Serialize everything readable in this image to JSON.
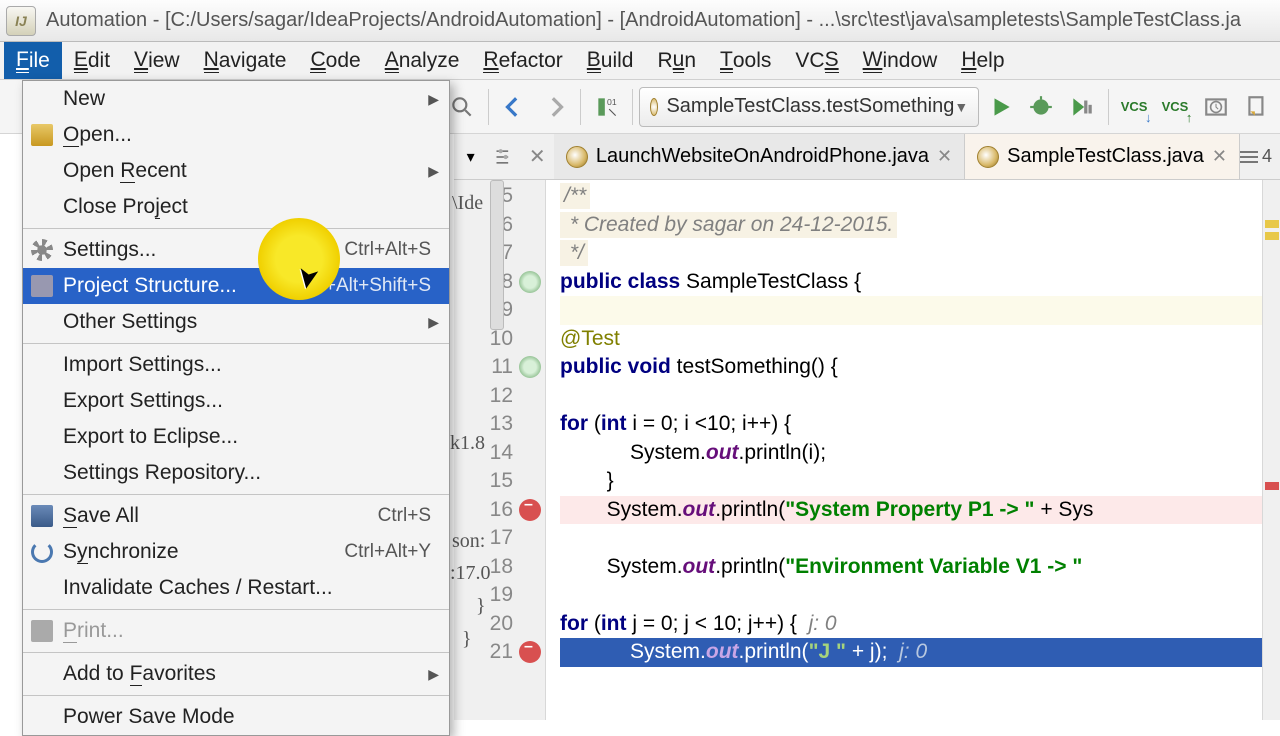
{
  "title": "Automation - [C:/Users/sagar/IdeaProjects/AndroidAutomation] - [AndroidAutomation] - ...\\src\\test\\java\\sampletests\\SampleTestClass.ja",
  "menubar": [
    "File",
    "Edit",
    "View",
    "Navigate",
    "Code",
    "Analyze",
    "Refactor",
    "Build",
    "Run",
    "Tools",
    "VCS",
    "Window",
    "Help"
  ],
  "menubar_mnemonics": [
    "F",
    "E",
    "V",
    "N",
    "C",
    "A",
    "R",
    "B",
    "u",
    "T",
    "S",
    "W",
    "H"
  ],
  "run_config": "SampleTestClass.testSomething",
  "toolbar_right_labels": {
    "vcs1": "VCS",
    "vcs2": "VCS"
  },
  "file_menu": [
    {
      "type": "item",
      "label": "New",
      "arrow": true
    },
    {
      "type": "item",
      "label": "Open...",
      "icon": "folder",
      "mn": "O"
    },
    {
      "type": "item",
      "label": "Open Recent",
      "arrow": true,
      "mn": "R"
    },
    {
      "type": "item",
      "label": "Close Project",
      "mn": "j"
    },
    {
      "type": "sep"
    },
    {
      "type": "item",
      "label": "Settings...",
      "shortcut": "Ctrl+Alt+S",
      "icon": "gear",
      "highlight": "yellow"
    },
    {
      "type": "item",
      "label": "Project Structure...",
      "shortcut": "Ctrl+Alt+Shift+S",
      "icon": "proj",
      "sel": true
    },
    {
      "type": "item",
      "label": "Other Settings",
      "arrow": true
    },
    {
      "type": "sep"
    },
    {
      "type": "item",
      "label": "Import Settings..."
    },
    {
      "type": "item",
      "label": "Export Settings..."
    },
    {
      "type": "item",
      "label": "Export to Eclipse..."
    },
    {
      "type": "item",
      "label": "Settings Repository..."
    },
    {
      "type": "sep"
    },
    {
      "type": "item",
      "label": "Save All",
      "shortcut": "Ctrl+S",
      "icon": "save",
      "mn": "S"
    },
    {
      "type": "item",
      "label": "Synchronize",
      "shortcut": "Ctrl+Alt+Y",
      "icon": "sync",
      "mn": "y"
    },
    {
      "type": "item",
      "label": "Invalidate Caches / Restart..."
    },
    {
      "type": "sep"
    },
    {
      "type": "item",
      "label": "Print...",
      "icon": "print",
      "dis": true,
      "mn": "P"
    },
    {
      "type": "sep"
    },
    {
      "type": "item",
      "label": "Add to Favorites",
      "arrow": true,
      "mn": "F"
    },
    {
      "type": "sep"
    },
    {
      "type": "item",
      "label": "Power Save Mode"
    }
  ],
  "editor_tabs": [
    {
      "name": "LaunchWebsiteOnAndroidPhone.java",
      "active": false
    },
    {
      "name": "SampleTestClass.java",
      "active": true
    }
  ],
  "tabs_right_count": "4",
  "behind_fragments": {
    "ide": "\\Ide",
    "k18": "k1.8",
    "son": "son:",
    "v17": ":17.0",
    "rb1": "}",
    "rb2": "}"
  },
  "code_lines": [
    {
      "n": 5,
      "html": "<span class='doc-bg'><span class='k-doc'>/**</span></span>"
    },
    {
      "n": 6,
      "html": "<span class='doc-bg'><span class='k-doc'> * Created by sagar on 24-12-2015.</span></span>"
    },
    {
      "n": 7,
      "html": "<span class='doc-bg'><span class='k-doc'> */</span></span>"
    },
    {
      "n": 8,
      "icon": "refresh",
      "html": "<span class='k-key'>public class</span> SampleTestClass {"
    },
    {
      "n": 9,
      "cls": "line-hl",
      "html": ""
    },
    {
      "n": 10,
      "html": "    <span class='k-ann'>@Test</span>"
    },
    {
      "n": 11,
      "icon": "refresh",
      "html": "    <span class='k-key'>public void</span> testSomething() {"
    },
    {
      "n": 12,
      "html": ""
    },
    {
      "n": 13,
      "html": "        <span class='k-key'>for</span> (<span class='k-key'>int</span> i = 0; i &lt;10; i++) {"
    },
    {
      "n": 14,
      "html": "            System.<span class='k-fld'>out</span>.println(i);"
    },
    {
      "n": 15,
      "html": "        }"
    },
    {
      "n": 16,
      "icon": "err",
      "cls": "line-err",
      "html": "        System.<span class='k-fld'>out</span>.println(<span class='k-str'>\"System Property P1 -&gt; \"</span> + Sys"
    },
    {
      "n": 17,
      "html": ""
    },
    {
      "n": 18,
      "html": "        System.<span class='k-fld'>out</span>.println(<span class='k-str'>\"Environment Variable V1 -&gt; \"</span>"
    },
    {
      "n": 19,
      "html": ""
    },
    {
      "n": 20,
      "html": "        <span class='k-key'>for</span> (<span class='k-key'>int</span> j = 0; j &lt; 10; j++) {  <span class='k-cmt'>j: 0</span>"
    },
    {
      "n": 21,
      "icon": "err",
      "cls": "line-sel",
      "html": "            System.<span class='k-fld'>out</span>.println(<span class='k-str'>\"J \"</span> + j);  <span class='k-cmt' style='color:#b8c8e0'>j: 0</span>"
    }
  ]
}
